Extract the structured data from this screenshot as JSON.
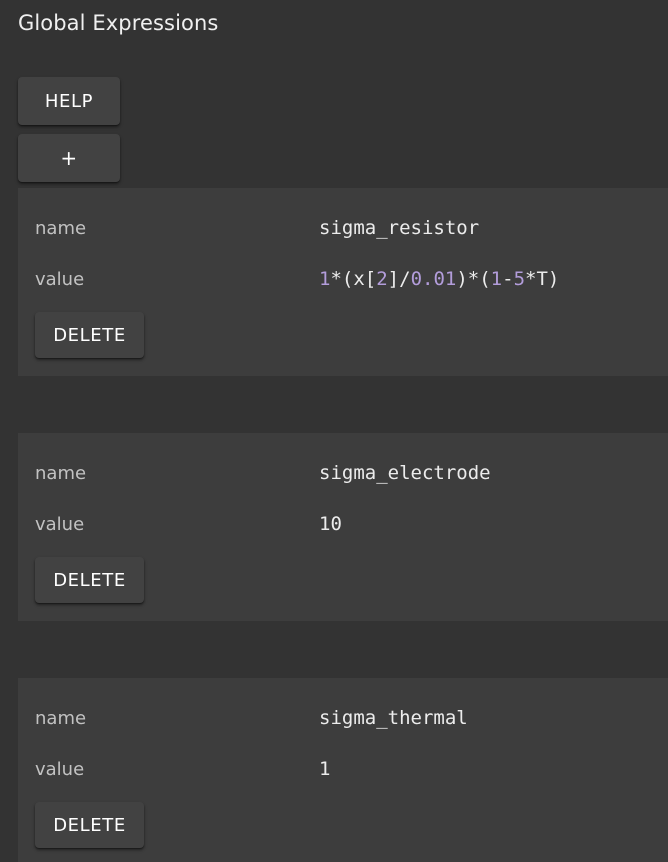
{
  "panel": {
    "title": "Global Expressions"
  },
  "toolbar": {
    "help_label": "HELP",
    "add_label": "+"
  },
  "fields": {
    "name_label": "name",
    "value_label": "value",
    "delete_label": "DELETE"
  },
  "expressions": [
    {
      "name": "sigma_resistor",
      "value": "1*(x[2]/0.01)*(1-5*T)",
      "value_tokens": {
        "t0": "1",
        "t1": "*(x[",
        "t2": "2",
        "t3": "]/",
        "t4": "0.01",
        "t5": ")*(",
        "t6": "1",
        "t7": "-",
        "t8": "5",
        "t9": "*T)"
      }
    },
    {
      "name": "sigma_electrode",
      "value": "10"
    },
    {
      "name": "sigma_thermal",
      "value": "1"
    }
  ],
  "colors": {
    "background": "#333333",
    "card": "#3d3d3d",
    "button": "#424242",
    "number_highlight": "#b39ddb",
    "text": "#ececec",
    "label": "#c2c2c2"
  }
}
